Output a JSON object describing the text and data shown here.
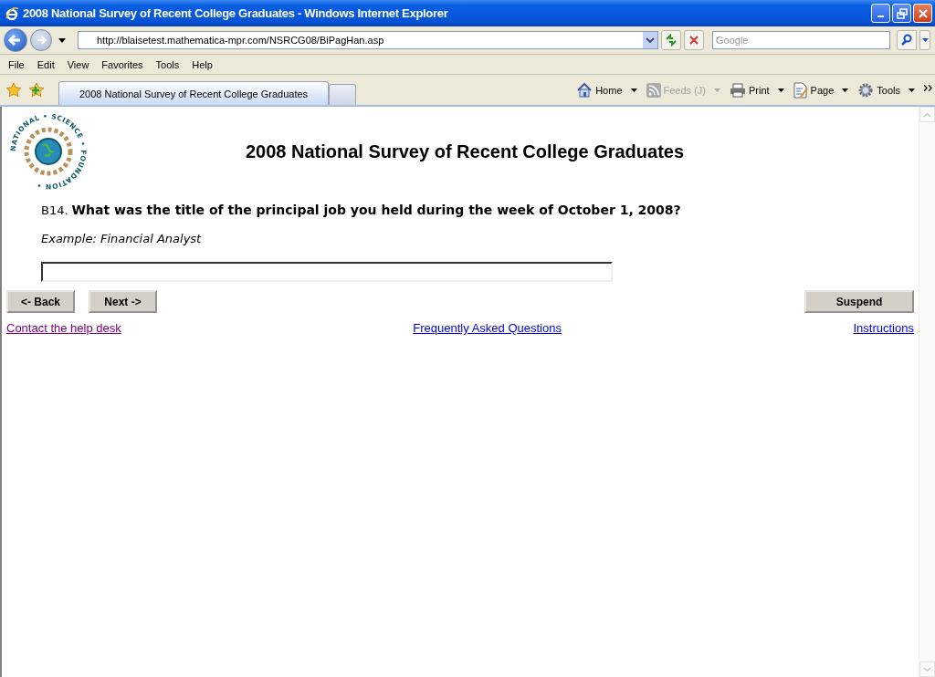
{
  "window": {
    "title": "2008 National Survey of Recent College Graduates - Windows Internet Explorer"
  },
  "address_bar": {
    "url": "http://blaisetest.mathematica-mpr.com/NSRCG08/BiPagHan.asp"
  },
  "search": {
    "placeholder": "Google"
  },
  "menu": [
    "File",
    "Edit",
    "View",
    "Favorites",
    "Tools",
    "Help"
  ],
  "tabs": [
    {
      "label": "2008 National Survey of Recent College Graduates",
      "selected": true
    }
  ],
  "command_bar": [
    {
      "kind": "home",
      "label": "Home",
      "disabled": false
    },
    {
      "kind": "feeds",
      "label": "Feeds (J)",
      "disabled": true
    },
    {
      "kind": "print",
      "label": "Print",
      "disabled": false
    },
    {
      "kind": "page",
      "label": "Page",
      "disabled": false
    },
    {
      "kind": "tools",
      "label": "Tools",
      "disabled": false
    }
  ],
  "page": {
    "logo_text": "NATIONAL • SCIENCE • FOUNDATION •",
    "heading": "2008 National Survey of Recent College Graduates",
    "question_number": "B14.",
    "question": "What was the title of the principal job you held during the week of October 1, 2008?",
    "example": "Example: Financial Analyst",
    "buttons": [
      {
        "label": "<- Back",
        "kind": "left"
      },
      {
        "label": "Next ->",
        "kind": "left"
      },
      {
        "label": "Suspend",
        "kind": "right"
      }
    ],
    "links": [
      {
        "label": "Contact the help desk",
        "visited": true
      },
      {
        "label": "Frequently Asked Questions",
        "visited": false
      },
      {
        "label": "Instructions",
        "visited": false
      }
    ]
  }
}
